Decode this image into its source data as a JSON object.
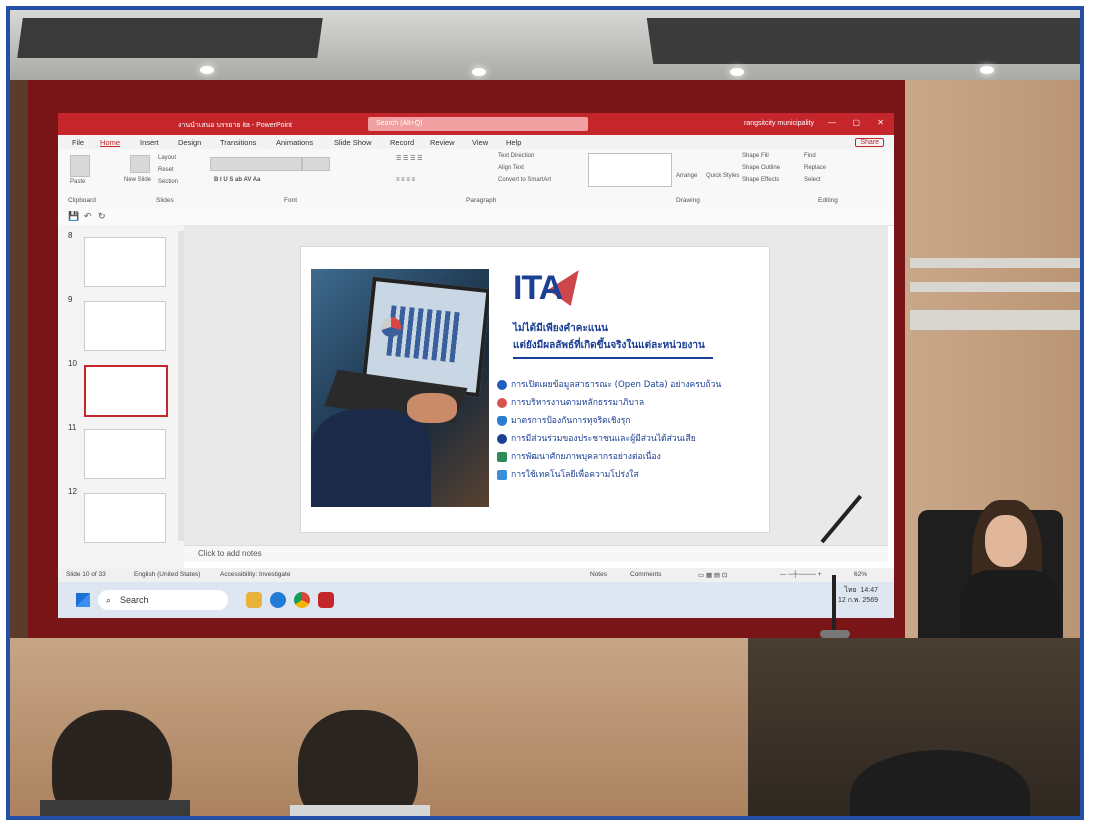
{
  "powerpoint": {
    "title": "งานนำเสนอ บรรยาย ita - PowerPoint",
    "search": "Search (Alt+Q)",
    "user": "rangsitcity municipality",
    "menu": [
      "File",
      "Home",
      "Insert",
      "Design",
      "Transitions",
      "Animations",
      "Slide Show",
      "Record",
      "Review",
      "View",
      "Help"
    ],
    "share": "Share",
    "ribbon": {
      "groups": [
        "Clipboard",
        "Slides",
        "Font",
        "Paragraph",
        "Drawing",
        "Editing"
      ],
      "clipboard": [
        "Paste"
      ],
      "slides": [
        "New Slide",
        "Layout",
        "Reset",
        "Section"
      ],
      "paragraph": [
        "Text Direction",
        "Align Text",
        "Convert to SmartArt"
      ],
      "drawing": [
        "Arrange",
        "Quick Styles",
        "Shape Fill",
        "Shape Outline",
        "Shape Effects"
      ],
      "editing": [
        "Find",
        "Replace",
        "Select"
      ]
    },
    "thumbnails": [
      {
        "num": "8",
        "selected": false
      },
      {
        "num": "9",
        "selected": false
      },
      {
        "num": "10",
        "selected": true
      },
      {
        "num": "11",
        "selected": false
      },
      {
        "num": "12",
        "selected": false
      }
    ],
    "slide": {
      "logo": "ITA",
      "subtitle1": "ไม่ได้มีเพียงคำคะแนน",
      "subtitle2": "แต่ยังมีผลลัพธ์ที่เกิดขึ้นจริงในแต่ละหน่วยงาน",
      "items": [
        {
          "text": "การเปิดเผยข้อมูลสาธารณะ (Open Data) อย่างครบถ้วน",
          "color": "#1f5fbf"
        },
        {
          "text": "การบริหารงานตามหลักธรรมาภิบาล",
          "color": "#d9534f"
        },
        {
          "text": "มาตรการป้องกันการทุจริตเชิงรุก",
          "color": "#2b7bd1"
        },
        {
          "text": "การมีส่วนร่วมของประชาชนและผู้มีส่วนได้ส่วนเสีย",
          "color": "#1b3f94"
        },
        {
          "text": "การพัฒนาศักยภาพบุคลากรอย่างต่อเนื่อง",
          "color": "#2e8b57"
        },
        {
          "text": "การใช้เทคโนโลยีเพื่อความโปร่งใส",
          "color": "#3a8fd8"
        }
      ]
    },
    "notes_placeholder": "Click to add notes",
    "status": {
      "slide": "Slide 10 of 33",
      "language": "English (United States)",
      "accessibility": "Accessibility: Investigate",
      "notes": "Notes",
      "comments": "Comments",
      "zoom": "62%"
    },
    "taskbar": {
      "search": "Search",
      "lang": "ไทย",
      "time": "14:47",
      "date": "12 ก.พ. 2569"
    }
  }
}
